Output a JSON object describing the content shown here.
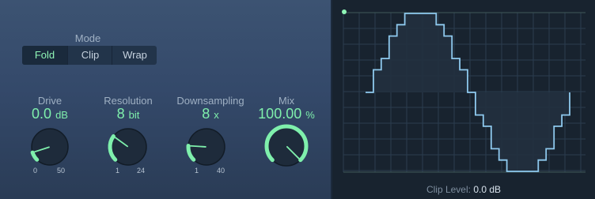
{
  "mode": {
    "label": "Mode",
    "options": [
      "Fold",
      "Clip",
      "Wrap"
    ],
    "selected": "Fold"
  },
  "knobs": [
    {
      "id": "drive",
      "label": "Drive",
      "value": "0.0",
      "unit": "dB",
      "min_label": "0",
      "max_label": "50",
      "fraction": 0.1
    },
    {
      "id": "resolution",
      "label": "Resolution",
      "value": "8",
      "unit": "bit",
      "min_label": "1",
      "max_label": "24",
      "fraction": 0.3
    },
    {
      "id": "downsampling",
      "label": "Downsampling",
      "value": "8",
      "unit": "x",
      "min_label": "1",
      "max_label": "40",
      "fraction": 0.18
    },
    {
      "id": "mix",
      "label": "Mix",
      "value": "100.00",
      "unit": "%",
      "min_label": "",
      "max_label": "",
      "fraction": 1.0
    }
  ],
  "display": {
    "clip_level_label": "Clip Level:",
    "clip_level_value": "0.0 dB"
  },
  "colors": {
    "accent": "#7ff0ac",
    "waveform": "#8ec9ee",
    "grid": "#2b3d4f"
  }
}
